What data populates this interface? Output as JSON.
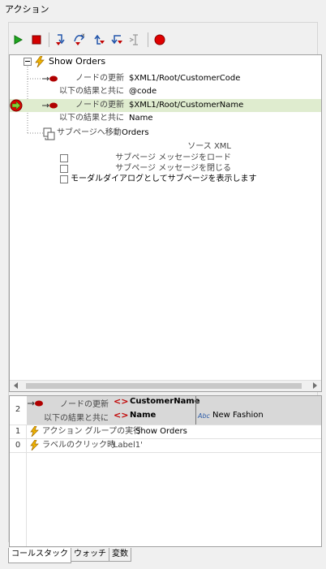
{
  "window": {
    "title": "アクション"
  },
  "tree": {
    "root": "Show Orders",
    "rows": [
      {
        "label": "ノードの更新",
        "value": "$XML1/Root/CustomerCode"
      },
      {
        "label": "以下の結果と共に",
        "value": "@code"
      },
      {
        "label": "ノードの更新",
        "value": "$XML1/Root/CustomerName"
      },
      {
        "label": "以下の結果と共に",
        "value": "Name"
      }
    ],
    "subpage": {
      "label": "サブページへ移動",
      "value": "Orders"
    },
    "options": {
      "source_label": "ソース XML",
      "load_label": "サブページ メッセージをロード",
      "close_label": "サブページ メッセージを閉じる",
      "modal_label": "モーダルダイアログとしてサブページを表示します"
    }
  },
  "callstack": {
    "rows": [
      {
        "index": "2",
        "line1_label": "ノードの更新",
        "line1_value": "CustomerName",
        "line2_label": "以下の結果と共に",
        "line2_value": "Name",
        "line2_abc": "Abc",
        "line2_result": "New Fashion"
      },
      {
        "index": "1",
        "label": "アクション グループの実行",
        "value": "Show Orders"
      },
      {
        "index": "0",
        "label": "ラベルのクリック時",
        "value": "'Label1'"
      }
    ]
  },
  "tabs": [
    "コールスタック",
    "ウォッチ",
    "変数"
  ],
  "colors": {
    "highlight": "#dfeccf",
    "run": "#1fa51f",
    "stop": "#d40000",
    "breakpoint": "#e00000"
  }
}
